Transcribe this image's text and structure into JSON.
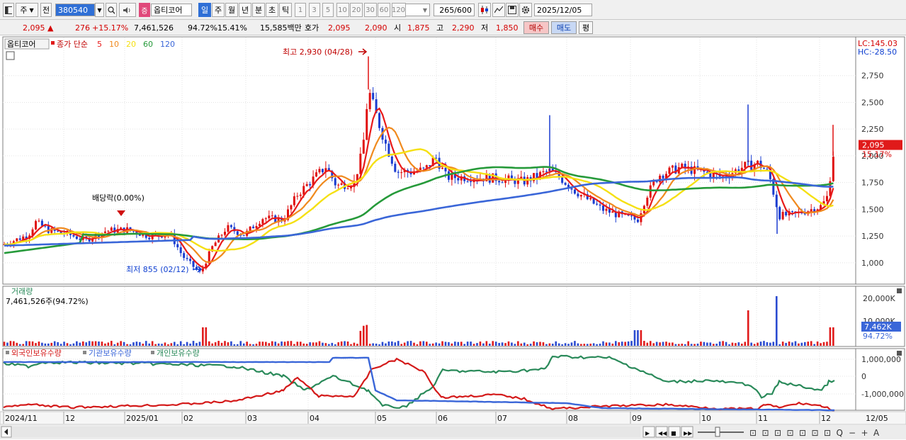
{
  "toolbar": {
    "type_label": "주",
    "prev_label": "전",
    "code": "380540",
    "stock_name": "옵티코어",
    "name_badge": "증",
    "periods": [
      "일",
      "주",
      "월",
      "년",
      "분",
      "초",
      "틱"
    ],
    "active_period": "일",
    "intervals": [
      "1",
      "3",
      "5",
      "10",
      "20",
      "30",
      "60",
      "120"
    ],
    "count": "265",
    "count_total": "/600",
    "date": "2025/12/05"
  },
  "quote": {
    "price": "2,095",
    "change_arrow": "▲",
    "change": "276",
    "change_pct": "+15.17%",
    "volume": "7,461,526",
    "vol_ratio": "94.72%",
    "turnover": "15.41%",
    "amount": "15,585백만",
    "bid_label": "호가",
    "ask": "2,095",
    "bid": "2,090",
    "open_label": "시",
    "open": "1,875",
    "high_label": "고",
    "high": "2,290",
    "low_label": "저",
    "low": "1,850",
    "buy_button": "매수",
    "sell_button": "매도",
    "eval_button": "평"
  },
  "price_panel": {
    "name_label": "옵티코어",
    "legend_prefix": "종가 단순",
    "ma": [
      {
        "label": "5",
        "color": "#e81a1a"
      },
      {
        "label": "10",
        "color": "#f08a1e"
      },
      {
        "label": "20",
        "color": "#f5e012"
      },
      {
        "label": "60",
        "color": "#269a3a"
      },
      {
        "label": "120",
        "color": "#3a66d8"
      }
    ],
    "lc": "LC:145.03",
    "hc": "HC:-28.50",
    "high_marker": "최고 2,930 (04/28)",
    "low_marker": "최저 855 (02/12)",
    "dividend_marker": "배당락(0.00%)",
    "current_price": "2,095",
    "current_pct": "15.17%",
    "y_ticks": [
      "2,750",
      "2,500",
      "2,250",
      "2,000",
      "1,750",
      "1,500",
      "1,250",
      "1,000"
    ]
  },
  "volume_panel": {
    "title": "거래량",
    "value": "7,461,526주(94.72%)",
    "y_ticks": [
      "20,000K",
      "10,000K"
    ],
    "current": "7,462K",
    "current_pct": "94.72%"
  },
  "holdings_panel": {
    "legends": [
      {
        "label": "외국인보유수량",
        "color": "#d41a1a"
      },
      {
        "label": "기관보유수량",
        "color": "#3a66d8"
      },
      {
        "label": "개인보유수량",
        "color": "#2a8a5a"
      }
    ],
    "y_ticks": [
      "1,000,000",
      "0",
      "-1,000,000"
    ]
  },
  "x_axis": {
    "labels": [
      "2024/11",
      "12",
      "2025/01",
      "02",
      "03",
      "04",
      "05",
      "06",
      "07",
      "08",
      "09",
      "10",
      "11",
      "12"
    ],
    "end_label": "12/05"
  },
  "chart_data": {
    "type": "candlestick",
    "price_range": [
      800,
      3000
    ],
    "high": 2930,
    "low": 855,
    "last_close": 2095,
    "volume_current": 7461526
  }
}
